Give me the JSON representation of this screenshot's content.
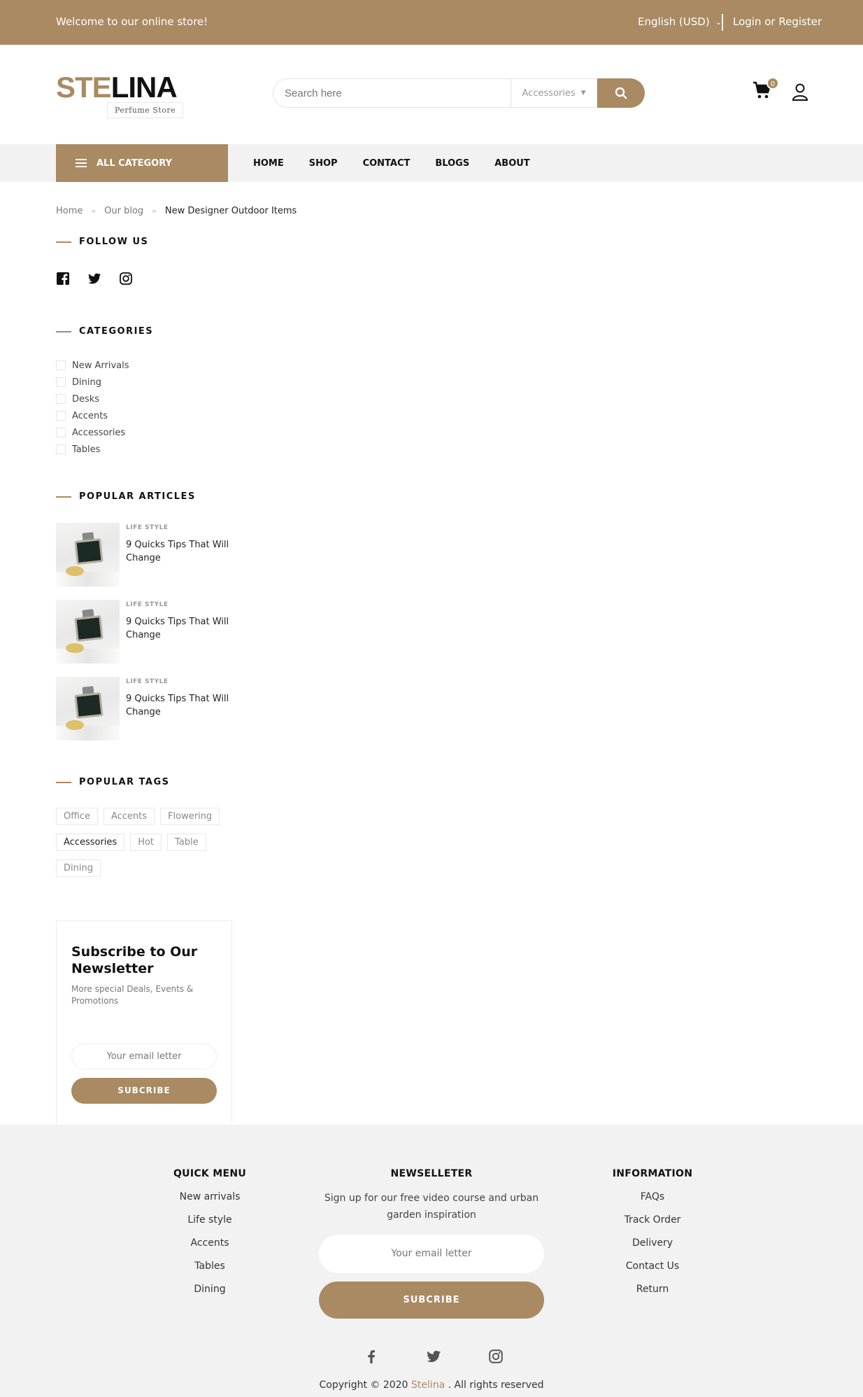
{
  "topbar": {
    "welcome": "Welcome to our online store!",
    "language": "English (USD)",
    "login": "Login or Register"
  },
  "header": {
    "logo_part1": "STE",
    "logo_part2": "LINA",
    "logo_tagline": "Perfume Store",
    "search_placeholder": "Search here",
    "search_category": "Accessories",
    "cart_count": "0"
  },
  "nav": {
    "all_category": "ALL CATEGORY",
    "items": [
      "HOME",
      "SHOP",
      "CONTACT",
      "BLOGS",
      "ABOUT"
    ]
  },
  "breadcrumb": {
    "home": "Home",
    "blog": "Our blog",
    "current": "New Designer Outdoor Items"
  },
  "sidebar": {
    "follow_title": "FOLLOW US",
    "categories_title": "CATEGORIES",
    "categories": [
      "New Arrivals",
      "Dining",
      "Desks",
      "Accents",
      "Accessories",
      "Tables"
    ],
    "popular_title": "POPULAR ARTICLES",
    "articles": [
      {
        "category": "LIFE STYLE",
        "title": "9 Quicks Tips That Will Change"
      },
      {
        "category": "LIFE STYLE",
        "title": "9 Quicks Tips That Will Change"
      },
      {
        "category": "LIFE STYLE",
        "title": "9 Quicks Tips That Will Change"
      }
    ],
    "tags_title": "POPULAR TAGS",
    "tags": [
      "Office",
      "Accents",
      "Flowering",
      "Accessories",
      "Hot",
      "Table",
      "Dining"
    ],
    "subscribe": {
      "title": "Subscribe to Our Newsletter",
      "text": "More special Deals, Events & Promotions",
      "placeholder": "Your email letter",
      "button": "SUBCRIBE"
    }
  },
  "footer": {
    "quick_title": "QUICK MENU",
    "quick_items": [
      "New arrivals",
      "Life style",
      "Accents",
      "Tables",
      "Dining"
    ],
    "news_title": "NEWSELLETER",
    "news_text": "Sign up for our free video course and urban garden inspiration",
    "news_placeholder": "Your email letter",
    "news_button": "SUBCRIBE",
    "info_title": "INFORMATION",
    "info_items": [
      "FAQs",
      "Track Order",
      "Delivery",
      "Contact Us",
      "Return"
    ],
    "copy_prefix": "Copyright © 2020",
    "copy_brand": "Stelina",
    "copy_suffix": ". All rights reserved"
  },
  "colors": {
    "accent": "#a98a62",
    "footer_bg": "#f2f2f2",
    "nav_bg": "#f2f2f2"
  },
  "icons": {
    "social": [
      "facebook-icon",
      "twitter-icon",
      "instagram-icon"
    ],
    "header": [
      "search-icon",
      "cart-icon",
      "user-icon"
    ]
  }
}
